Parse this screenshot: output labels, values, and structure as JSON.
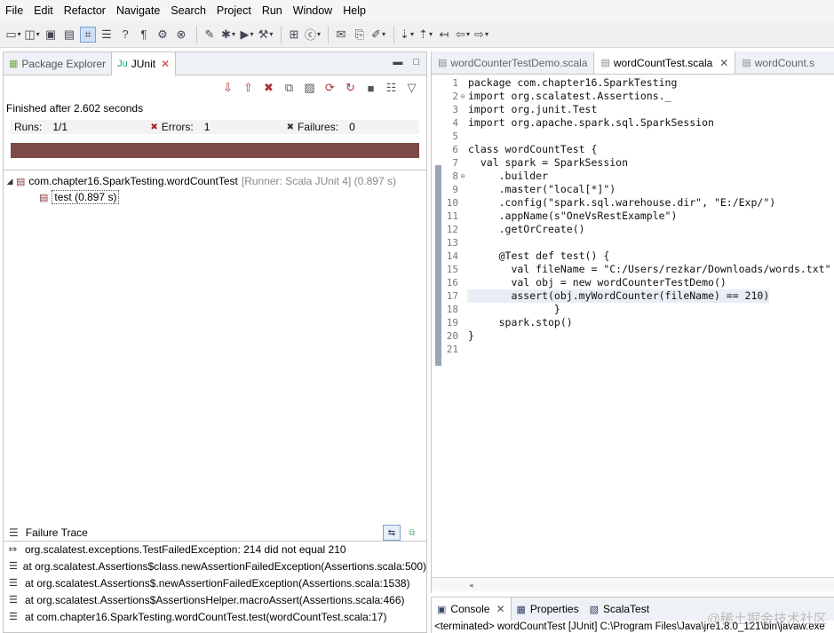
{
  "menu": [
    "File",
    "Edit",
    "Refactor",
    "Navigate",
    "Search",
    "Project",
    "Run",
    "Window",
    "Help"
  ],
  "left_panel": {
    "tabs": [
      {
        "label": "Package Explorer",
        "active": false
      },
      {
        "label": "JUnit",
        "active": true
      }
    ],
    "status": "Finished after 2.602 seconds",
    "counters": {
      "runs_label": "Runs:",
      "runs_value": "1/1",
      "errors_label": "Errors:",
      "errors_value": "1",
      "failures_label": "Failures:",
      "failures_value": "0"
    },
    "progress_color": "#7c4b46",
    "tree": {
      "suite": "com.chapter16.SparkTesting.wordCountTest",
      "suite_runner": "[Runner: Scala JUnit 4] (0.897 s)",
      "test": "test (0.897 s)"
    },
    "failure_trace": {
      "title": "Failure Trace",
      "lines": [
        "org.scalatest.exceptions.TestFailedException: 214 did not equal 210",
        "at org.scalatest.Assertions$class.newAssertionFailedException(Assertions.scala:500)",
        "at org.scalatest.Assertions$.newAssertionFailedException(Assertions.scala:1538)",
        "at org.scalatest.Assertions$AssertionsHelper.macroAssert(Assertions.scala:466)",
        "at com.chapter16.SparkTesting.wordCountTest.test(wordCountTest.scala:17)"
      ]
    }
  },
  "editor": {
    "tabs": [
      {
        "label": "wordCounterTestDemo.scala",
        "active": false
      },
      {
        "label": "wordCountTest.scala",
        "active": true
      },
      {
        "label": "wordCount.s",
        "active": false
      }
    ],
    "lines": [
      {
        "n": "1",
        "text": "package com.chapter16.SparkTesting"
      },
      {
        "n": "2",
        "text": "import org.scalatest.Assertions._",
        "fold": true
      },
      {
        "n": "3",
        "text": "import org.junit.Test"
      },
      {
        "n": "4",
        "text": "import org.apache.spark.sql.SparkSession"
      },
      {
        "n": "5",
        "text": ""
      },
      {
        "n": "6",
        "text": "class wordCountTest {"
      },
      {
        "n": "7",
        "text": "  val spark = SparkSession"
      },
      {
        "n": "8",
        "text": "     .builder",
        "fold": true
      },
      {
        "n": "9",
        "text": "     .master(\"local[*]\")"
      },
      {
        "n": "10",
        "text": "     .config(\"spark.sql.warehouse.dir\", \"E:/Exp/\")"
      },
      {
        "n": "11",
        "text": "     .appName(s\"OneVsRestExample\")"
      },
      {
        "n": "12",
        "text": "     .getOrCreate()"
      },
      {
        "n": "13",
        "text": ""
      },
      {
        "n": "14",
        "text": "     @Test def test() {"
      },
      {
        "n": "15",
        "text": "       val fileName = \"C:/Users/rezkar/Downloads/words.txt\""
      },
      {
        "n": "16",
        "text": "       val obj = new wordCounterTestDemo()"
      },
      {
        "n": "17",
        "text": "       assert(obj.myWordCounter(fileName) == 210)",
        "highlight": true
      },
      {
        "n": "18",
        "text": "              }"
      },
      {
        "n": "19",
        "text": "     spark.stop()"
      },
      {
        "n": "20",
        "text": "}"
      },
      {
        "n": "21",
        "text": ""
      }
    ]
  },
  "console": {
    "tabs": [
      {
        "label": "Console",
        "active": true
      },
      {
        "label": "Properties",
        "active": false
      },
      {
        "label": "ScalaTest",
        "active": false
      }
    ],
    "terminated": "<terminated> wordCountTest [JUnit] C:\\Program Files\\Java\\jre1.8.0_121\\bin\\javaw.exe"
  },
  "watermark": "@稀土掘金技术社区"
}
